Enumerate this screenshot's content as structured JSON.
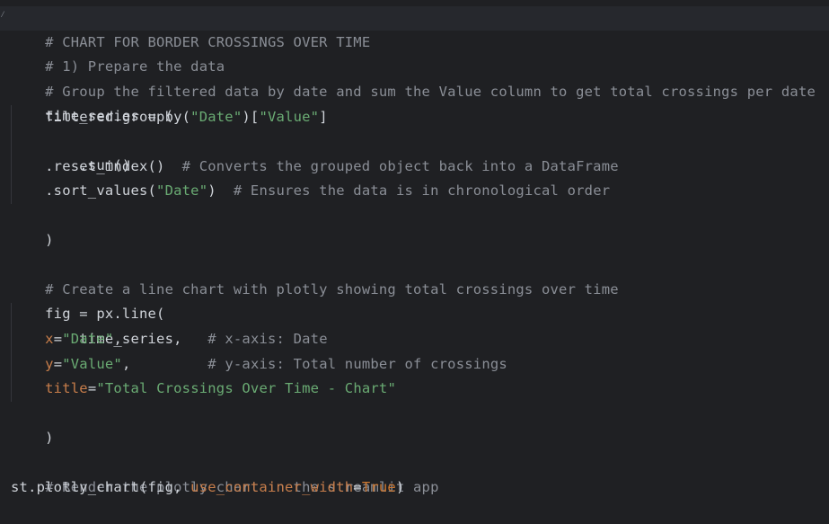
{
  "code": {
    "l1": "# CHART FOR BORDER CROSSINGS OVER TIME",
    "l2": "# 1) Prepare the data",
    "l3": "# Group the filtered data by date and sum the Value column to get total crossings per date",
    "l4": "time_series = (",
    "l5_a": "    filtered.groupby(",
    "l5_b": "\"Date\"",
    "l5_c": ")[",
    "l5_d": "\"Value\"",
    "l5_e": "]",
    "l6": "    .sum()",
    "l7_a": "    .reset_index()  ",
    "l7_b": "# Converts the grouped object back into a DataFrame",
    "l8_a": "    .sort_values(",
    "l8_b": "\"Date\"",
    "l8_c": ")  ",
    "l8_d": "# Ensures the data is in chronological order",
    "l9": ")",
    "l11": "# Create a line chart with plotly showing total crossings over time",
    "l12": "fig = px.line(",
    "l13": "    time_series,",
    "l14_a": "    ",
    "l14_b": "x",
    "l14_c": "=",
    "l14_d": "\"Date\"",
    "l14_e": ",          ",
    "l14_f": "# x-axis: Date",
    "l15_a": "    ",
    "l15_b": "y",
    "l15_c": "=",
    "l15_d": "\"Value\"",
    "l15_e": ",         ",
    "l15_f": "# y-axis: Total number of crossings",
    "l16_a": "    ",
    "l16_b": "title",
    "l16_c": "=",
    "l16_d": "\"Total Crossings Over Time - Chart\"",
    "l17": ")",
    "l19": "# Render the plotly chart in the streamlit app",
    "l20_a": "st.plotly_chart(fig, ",
    "l20_b": "use_container_width",
    "l20_c": "=",
    "l20_d": "True",
    "l20_e": ")"
  },
  "colors": {
    "background": "#1f2023",
    "comment": "#8a8e96",
    "string": "#6aab73",
    "parameter": "#c77d4a",
    "keyword": "#cc7832",
    "text": "#cfd3d9"
  }
}
